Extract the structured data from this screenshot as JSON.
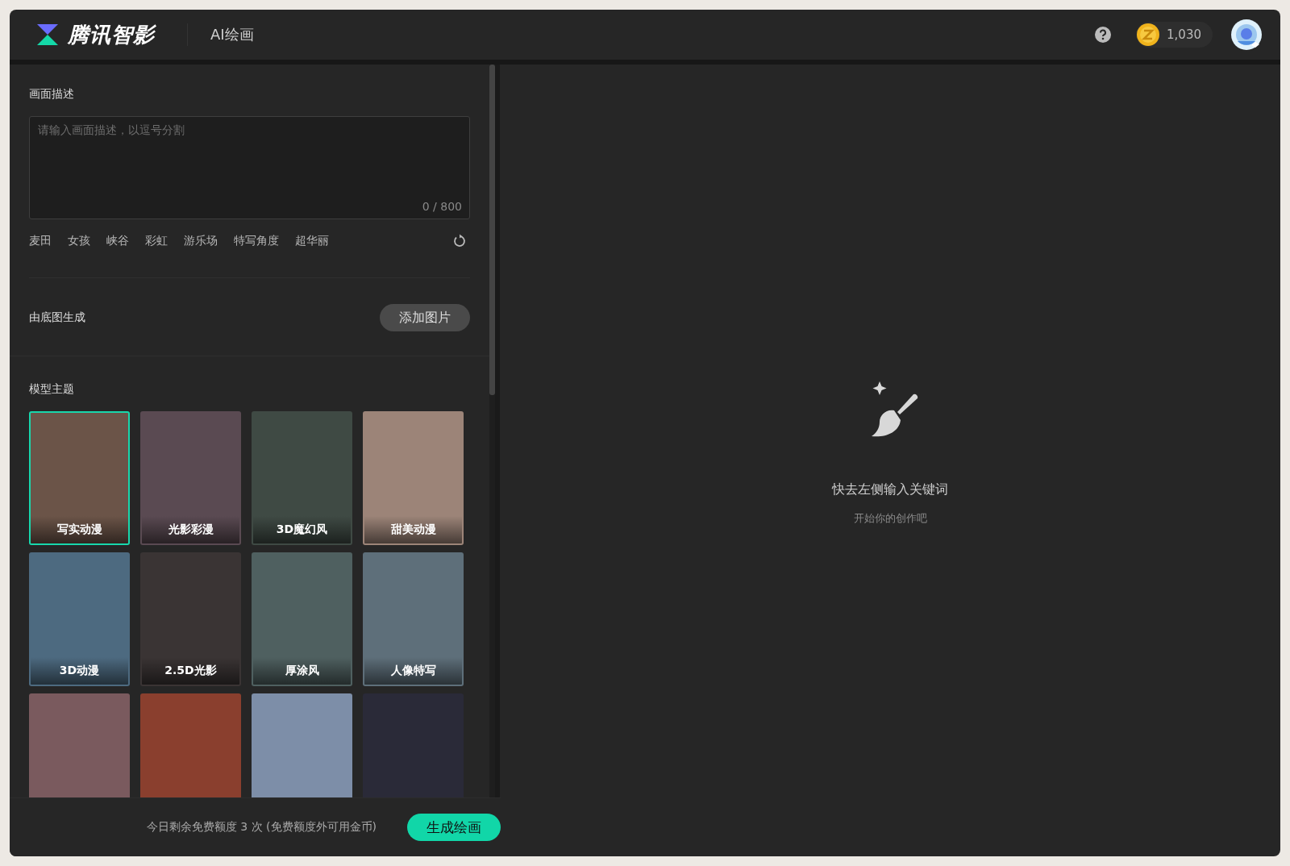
{
  "header": {
    "brand": "腾讯智影",
    "page_title": "AI绘画",
    "coins": "1,030"
  },
  "prompt": {
    "label": "画面描述",
    "placeholder": "请输入画面描述，以逗号分割",
    "counter": "0 / 800",
    "suggestions": [
      "麦田",
      "女孩",
      "峡谷",
      "彩虹",
      "游乐场",
      "特写角度",
      "超华丽"
    ]
  },
  "base_image": {
    "label": "由底图生成",
    "button": "添加图片"
  },
  "models": {
    "label": "模型主题",
    "items": [
      {
        "label": "写实动漫",
        "selected": true,
        "color": "#6b5448"
      },
      {
        "label": "光影彩漫",
        "selected": false,
        "color": "#5a4a52"
      },
      {
        "label": "3D魔幻风",
        "selected": false,
        "color": "#3f4a44"
      },
      {
        "label": "甜美动漫",
        "selected": false,
        "color": "#9c8478"
      },
      {
        "label": "3D动漫",
        "selected": false,
        "color": "#4d6a80"
      },
      {
        "label": "2.5D光影",
        "selected": false,
        "color": "#3a3434"
      },
      {
        "label": "厚涂风",
        "selected": false,
        "color": "#4f6060"
      },
      {
        "label": "人像特写",
        "selected": false,
        "color": "#5e6f7a"
      },
      {
        "selected": false,
        "color": "#7a5a5e"
      },
      {
        "selected": false,
        "color": "#8a3f2e"
      },
      {
        "selected": false,
        "color": "#7d8ea8"
      },
      {
        "selected": false,
        "color": "#2a2a38"
      }
    ]
  },
  "footer": {
    "quota_text": "今日剩余免费额度 3 次 (免费额度外可用金币)",
    "generate_button": "生成绘画"
  },
  "empty_state": {
    "title": "快去左侧输入关键词",
    "subtitle": "开始你的创作吧"
  }
}
